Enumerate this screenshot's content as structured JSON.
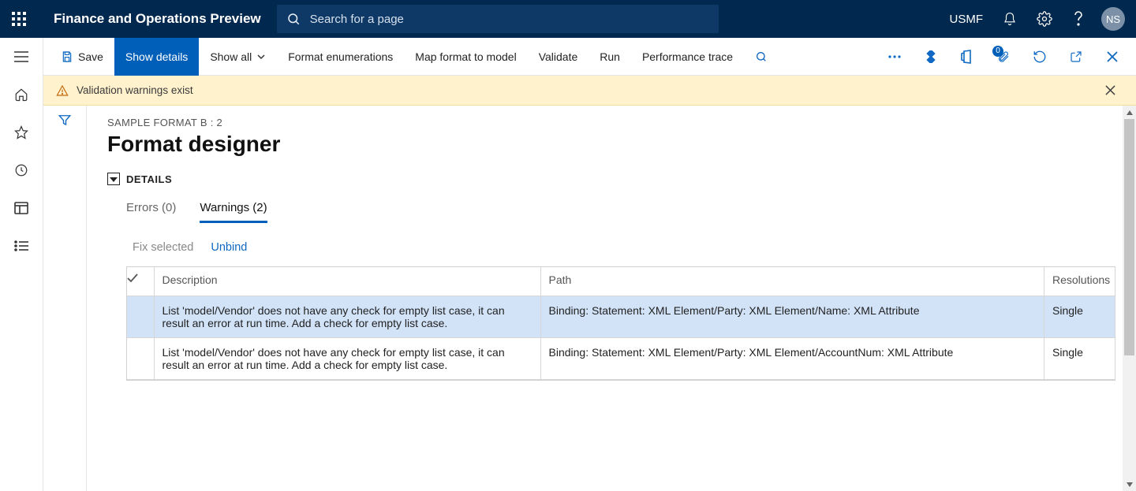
{
  "header": {
    "app_title": "Finance and Operations Preview",
    "search_placeholder": "Search for a page",
    "company": "USMF",
    "avatar_initials": "NS"
  },
  "action_bar": {
    "save_label": "Save",
    "show_details_label": "Show details",
    "show_all_label": "Show all",
    "format_enumerations_label": "Format enumerations",
    "map_format_label": "Map format to model",
    "validate_label": "Validate",
    "run_label": "Run",
    "performance_trace_label": "Performance trace",
    "attachment_badge": "0"
  },
  "banner": {
    "text": "Validation warnings exist"
  },
  "page": {
    "breadcrumb": "SAMPLE FORMAT B : 2",
    "title": "Format designer",
    "details_label": "DETAILS"
  },
  "tabs": {
    "errors_label": "Errors (0)",
    "warnings_label": "Warnings (2)"
  },
  "sub_actions": {
    "fix_selected": "Fix selected",
    "unbind": "Unbind"
  },
  "grid": {
    "headers": {
      "description": "Description",
      "path": "Path",
      "resolutions": "Resolutions"
    },
    "rows": [
      {
        "description": "List 'model/Vendor' does not have any check for empty list case, it can result an error at run time. Add a check for empty list case.",
        "path": "Binding: Statement: XML Element/Party: XML Element/Name: XML Attribute",
        "resolutions": "Single",
        "selected": true
      },
      {
        "description": "List 'model/Vendor' does not have any check for empty list case, it can result an error at run time. Add a check for empty list case.",
        "path": "Binding: Statement: XML Element/Party: XML Element/AccountNum: XML Attribute",
        "resolutions": "Single",
        "selected": false
      }
    ]
  }
}
